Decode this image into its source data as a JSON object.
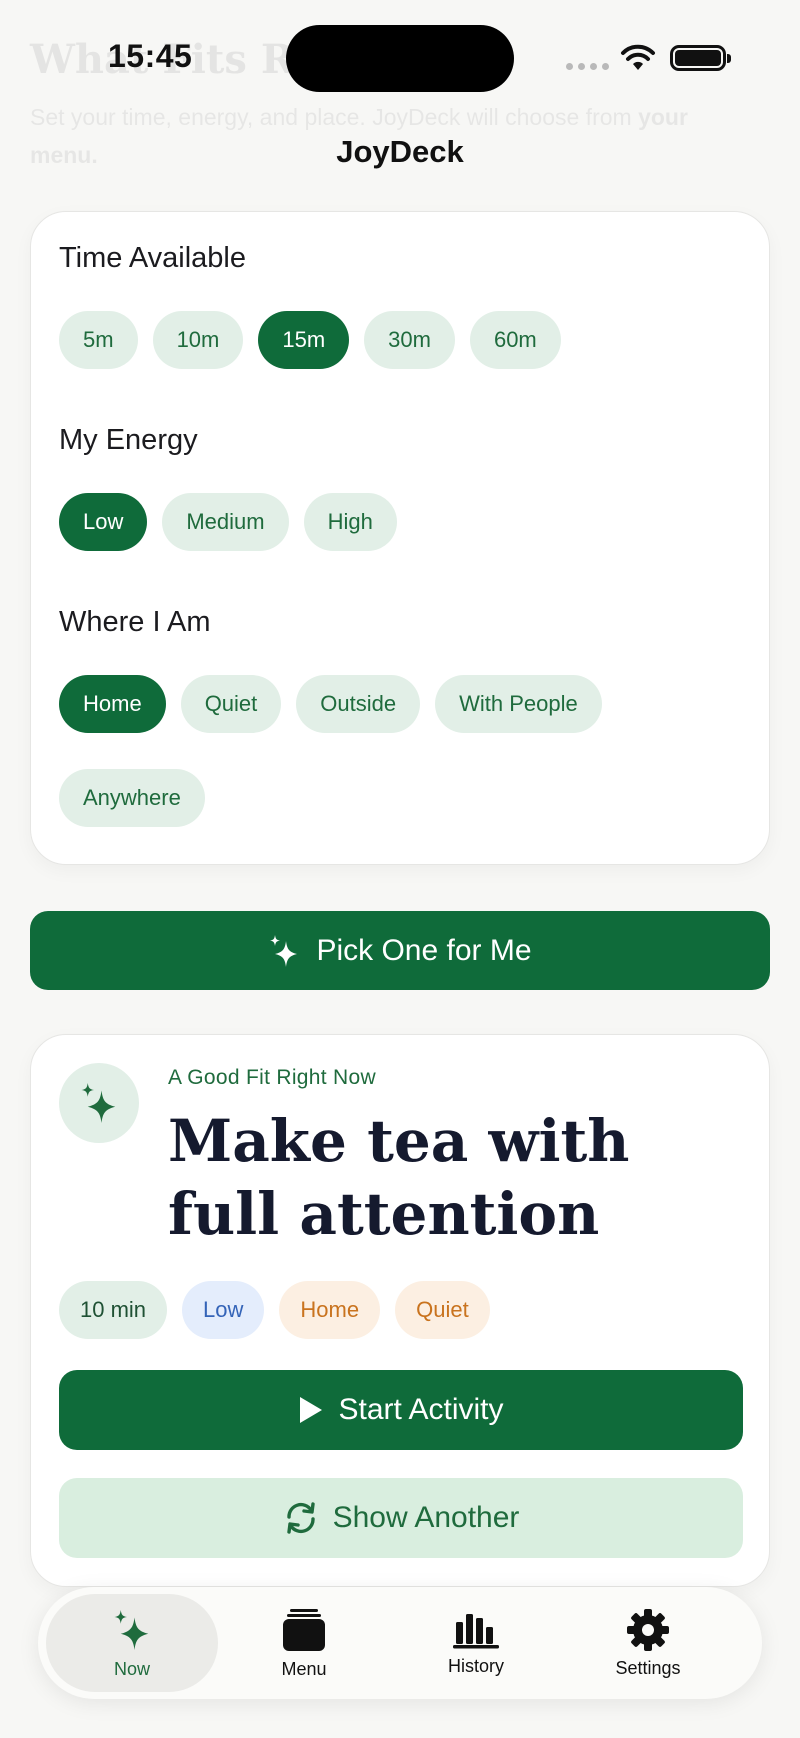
{
  "background": {
    "title": "What Fits Right Now",
    "subtitle": "Set your time, energy, and place. JoyDeck will choose from",
    "subtitle_bold": "your menu."
  },
  "status_bar": {
    "time": "15:45"
  },
  "nav": {
    "title": "JoyDeck"
  },
  "filters": {
    "time": {
      "title": "Time Available",
      "options": [
        "5m",
        "10m",
        "15m",
        "30m",
        "60m"
      ],
      "selected": "15m"
    },
    "energy": {
      "title": "My Energy",
      "options": [
        "Low",
        "Medium",
        "High"
      ],
      "selected": "Low"
    },
    "place": {
      "title": "Where I Am",
      "options": [
        "Home",
        "Quiet",
        "Outside",
        "With People",
        "Anywhere"
      ],
      "selected": "Home"
    }
  },
  "pick_button": {
    "label": "Pick One for Me",
    "icon": "sparkles-icon"
  },
  "result": {
    "label": "A Good Fit Right Now",
    "title": "Make tea with full attention",
    "tags": [
      "10 min",
      "Low",
      "Home",
      "Quiet"
    ],
    "start_label": "Start Activity",
    "another_label": "Show Another"
  },
  "tab_bar": {
    "tabs": [
      {
        "label": "Now",
        "icon": "sparkles-icon",
        "active": true
      },
      {
        "label": "Menu",
        "icon": "card-stack-icon",
        "active": false
      },
      {
        "label": "History",
        "icon": "bar-chart-icon",
        "active": false
      },
      {
        "label": "Settings",
        "icon": "gear-icon",
        "active": false
      }
    ]
  },
  "colors": {
    "accent": "#0f6b3a",
    "chip_bg": "#e2efe7",
    "energy_tag": "#e4edfc",
    "place_tag": "#fcefe2"
  }
}
